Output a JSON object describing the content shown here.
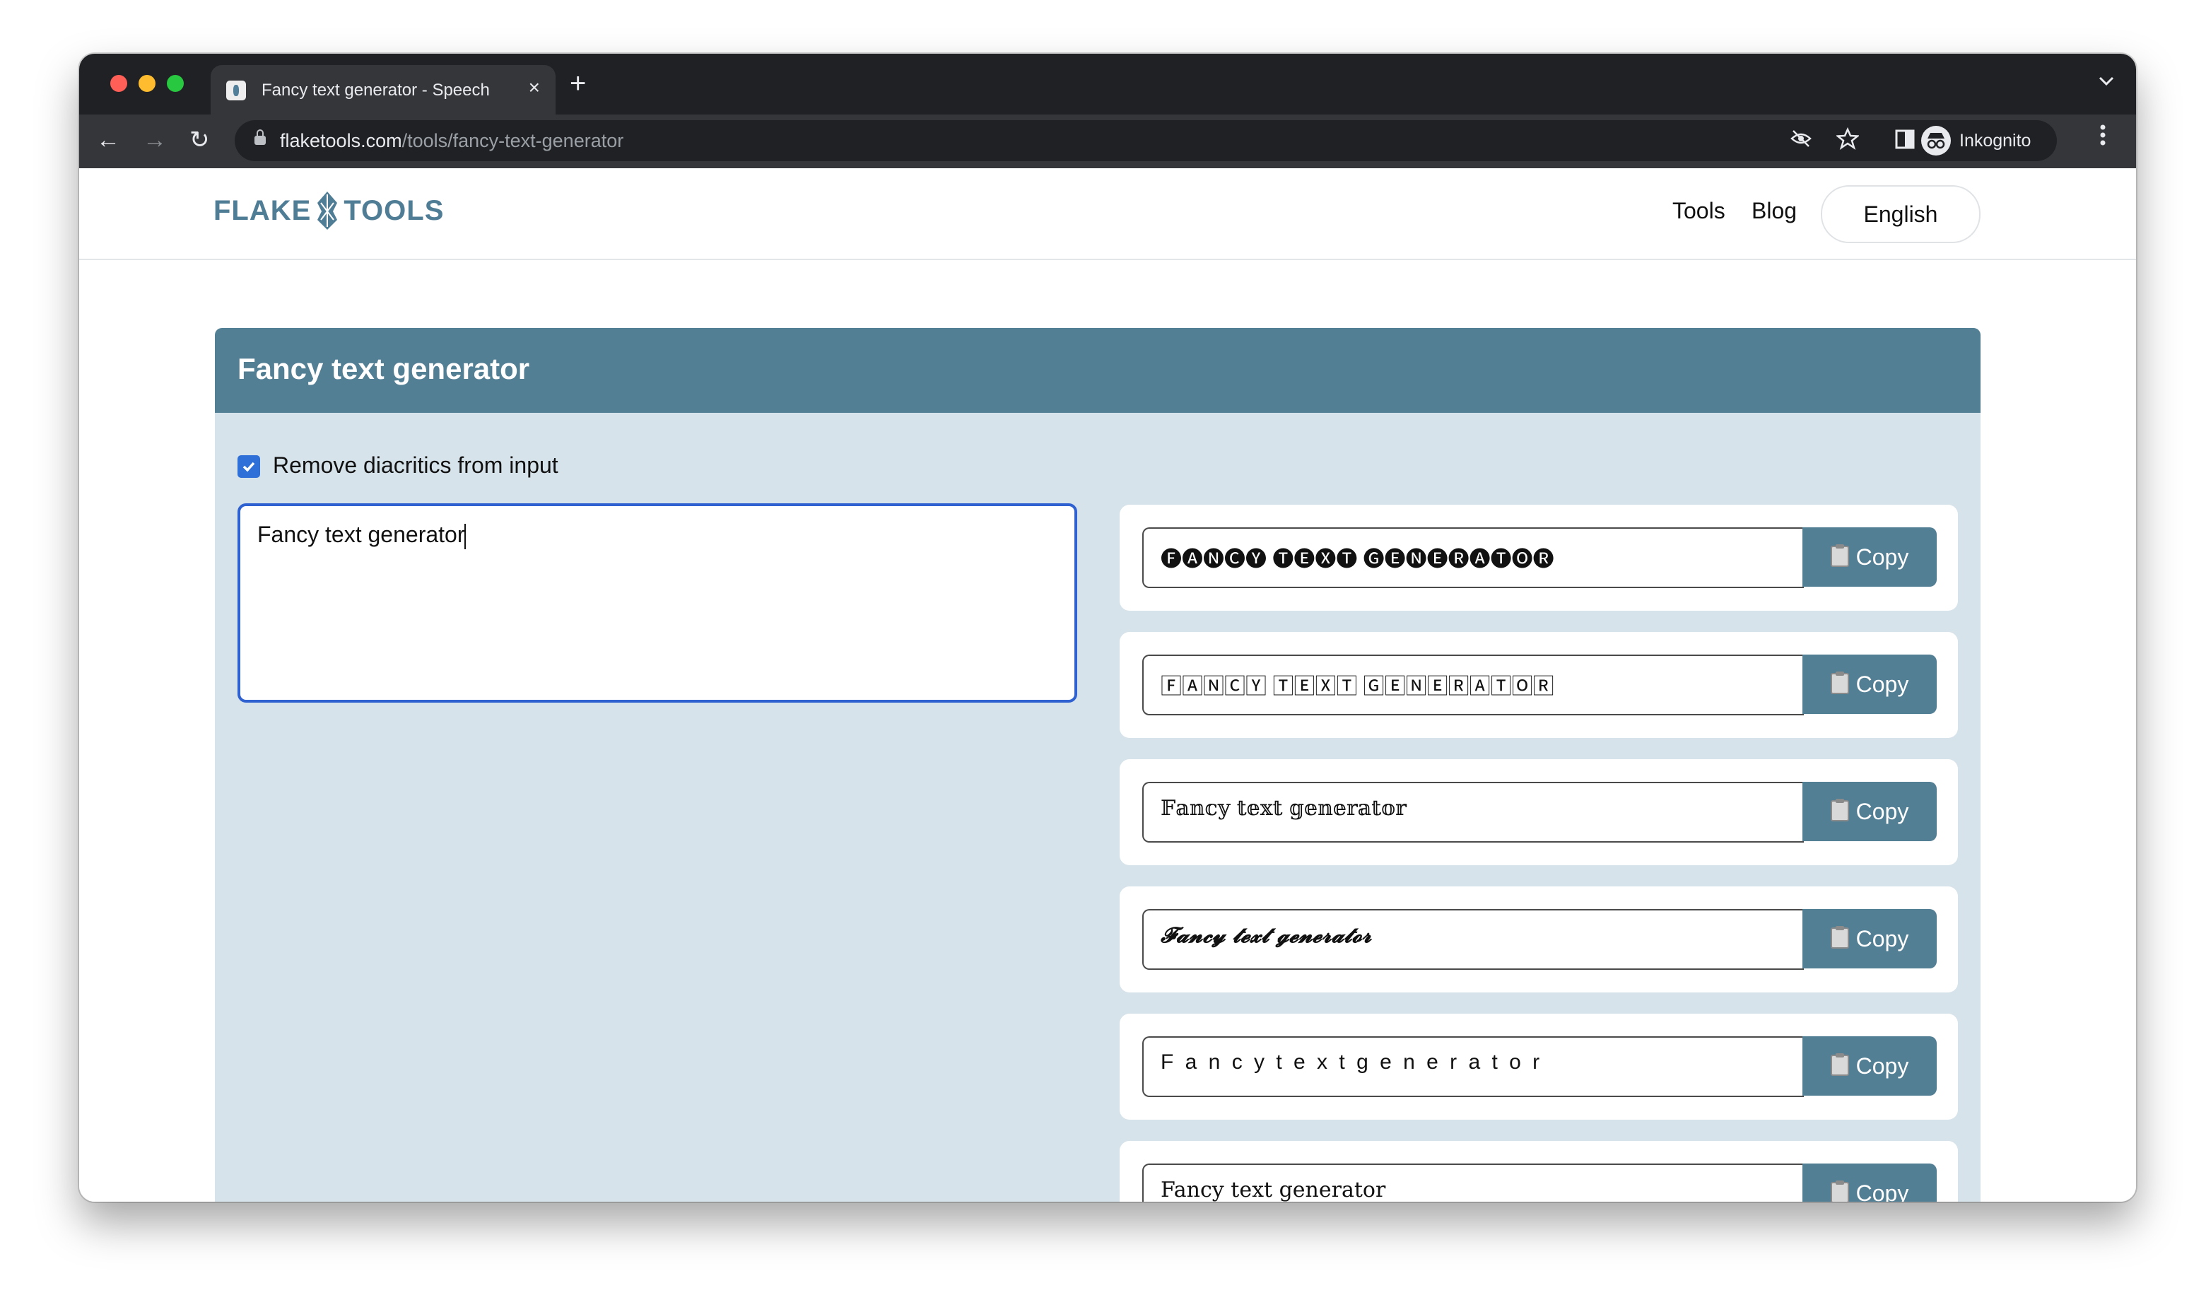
{
  "browser": {
    "tab_title": "Fancy text generator - Speech",
    "tab_close": "×",
    "new_tab": "+",
    "url_domain": "flaketools.com",
    "url_path": "/tools/fancy-text-generator",
    "profile_label": "Inkognito",
    "nav": {
      "back": "←",
      "forward": "→",
      "reload": "↻"
    },
    "icons": [
      "eye-off-icon",
      "star-icon",
      "side-panel-icon",
      "kebab-menu-icon"
    ]
  },
  "site": {
    "logo_left": "FLAKE",
    "logo_right": "TOOLS",
    "nav": {
      "tools": "Tools",
      "blog": "Blog",
      "language": "English"
    }
  },
  "tool": {
    "title": "Fancy text generator",
    "checkbox_label": "Remove diacritics from input",
    "checkbox_checked": true,
    "input_value": "Fancy text generator",
    "copy_label": "Copy",
    "results": [
      "🅕🅐🅝🅒🅨 🅣🅔🅧🅣 🅖🅔🅝🅔🅡🅐🅣🅞🅡",
      "🄵🄰🄽🄲🅈 🅃🄴🅇🅃 🄶🄴🄽🄴🅁🄰🅃🄾🅁",
      "𝔽𝕒𝕟𝕔𝕪 𝕥𝕖𝕩𝕥 𝕘𝕖𝕟𝕖𝕣𝕒𝕥𝕠𝕣",
      "𝓕𝓪𝓷𝓬𝔂 𝓽𝓮𝔁𝓽 𝓰𝓮𝓷𝓮𝓻𝓪𝓽𝓸𝓻",
      "F a n c y  t e x t  g e n e r a t o r",
      "Fancy text generator"
    ]
  },
  "colors": {
    "brand": "#537f95",
    "card_bg": "#d7e3ea",
    "focus": "#2f62d0",
    "checkbox": "#2f6fd8",
    "chrome_dark": "#202124",
    "chrome_toolbar": "#35363a"
  }
}
